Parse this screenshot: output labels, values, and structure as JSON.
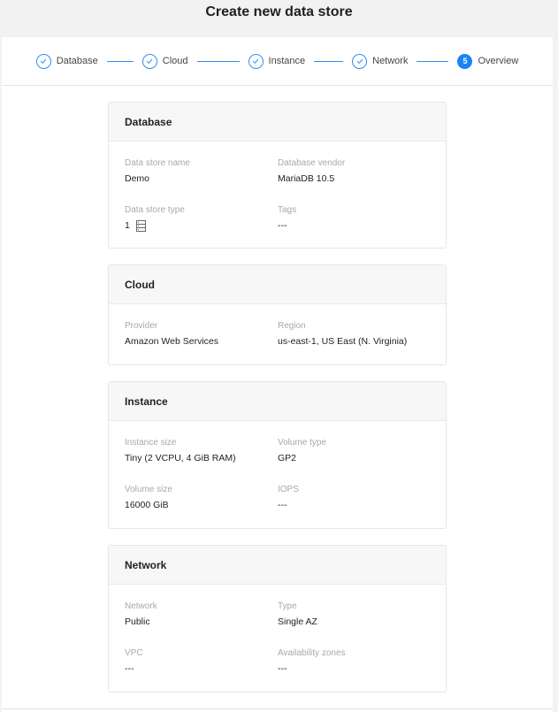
{
  "page": {
    "title": "Create new data store"
  },
  "stepper": {
    "steps": [
      {
        "label": "Database",
        "state": "complete",
        "icon": "check-icon"
      },
      {
        "label": "Cloud",
        "state": "complete",
        "icon": "check-icon"
      },
      {
        "label": "Instance",
        "state": "complete",
        "icon": "check-icon"
      },
      {
        "label": "Network",
        "state": "complete",
        "icon": "check-icon"
      },
      {
        "label": "Overview",
        "state": "active",
        "number": "5"
      }
    ],
    "accent_color": "#1b84f2"
  },
  "sections": {
    "database": {
      "title": "Database",
      "fields": [
        {
          "label": "Data store name",
          "value": "Demo"
        },
        {
          "label": "Database vendor",
          "value": "MariaDB 10.5"
        },
        {
          "label": "Data store type",
          "value": "1",
          "icon": "server-stack-icon"
        },
        {
          "label": "Tags",
          "value": "---"
        }
      ]
    },
    "cloud": {
      "title": "Cloud",
      "fields": [
        {
          "label": "Provider",
          "value": "Amazon Web Services"
        },
        {
          "label": "Region",
          "value": "us-east-1, US East (N. Virginia)"
        }
      ]
    },
    "instance": {
      "title": "Instance",
      "fields": [
        {
          "label": "Instance size",
          "value": "Tiny (2 VCPU, 4 GiB RAM)"
        },
        {
          "label": "Volume type",
          "value": "GP2"
        },
        {
          "label": "Volume size",
          "value": "16000 GiB"
        },
        {
          "label": "IOPS",
          "value": "---"
        }
      ]
    },
    "network": {
      "title": "Network",
      "fields": [
        {
          "label": "Network",
          "value": "Public"
        },
        {
          "label": "Type",
          "value": "Single AZ"
        },
        {
          "label": "VPC",
          "value": "---"
        },
        {
          "label": "Availability zones",
          "value": "---"
        }
      ]
    }
  }
}
